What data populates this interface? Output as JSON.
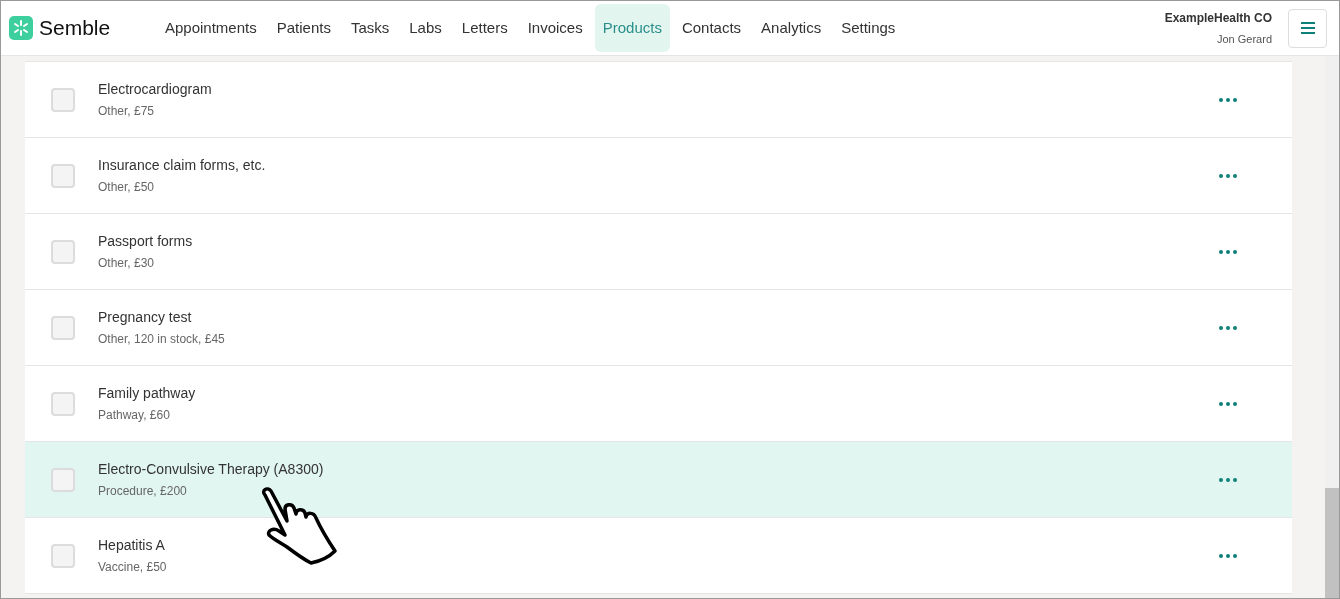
{
  "brand": {
    "name": "Semble"
  },
  "nav": [
    {
      "label": "Appointments",
      "selected": false
    },
    {
      "label": "Patients",
      "selected": false
    },
    {
      "label": "Tasks",
      "selected": false
    },
    {
      "label": "Labs",
      "selected": false
    },
    {
      "label": "Letters",
      "selected": false
    },
    {
      "label": "Invoices",
      "selected": false
    },
    {
      "label": "Products",
      "selected": true
    },
    {
      "label": "Contacts",
      "selected": false
    },
    {
      "label": "Analytics",
      "selected": false
    },
    {
      "label": "Settings",
      "selected": false
    }
  ],
  "account": {
    "organisation": "ExampleHealth CO",
    "user": "Jon Gerard"
  },
  "products": [
    {
      "name": "Electrocardiogram",
      "details": "Other, £75",
      "checked": false,
      "selected": false
    },
    {
      "name": "Insurance claim forms, etc.",
      "details": "Other, £50",
      "checked": false,
      "selected": false
    },
    {
      "name": "Passport forms",
      "details": "Other, £30",
      "checked": false,
      "selected": false
    },
    {
      "name": "Pregnancy test",
      "details": "Other, 120 in stock, £45",
      "checked": false,
      "selected": false
    },
    {
      "name": "Family pathway",
      "details": "Pathway, £60",
      "checked": false,
      "selected": false
    },
    {
      "name": "Electro-Convulsive Therapy (A8300)",
      "details": "Procedure, £200",
      "checked": false,
      "selected": true
    },
    {
      "name": "Hepatitis A",
      "details": "Vaccine, £50",
      "checked": false,
      "selected": false
    }
  ]
}
